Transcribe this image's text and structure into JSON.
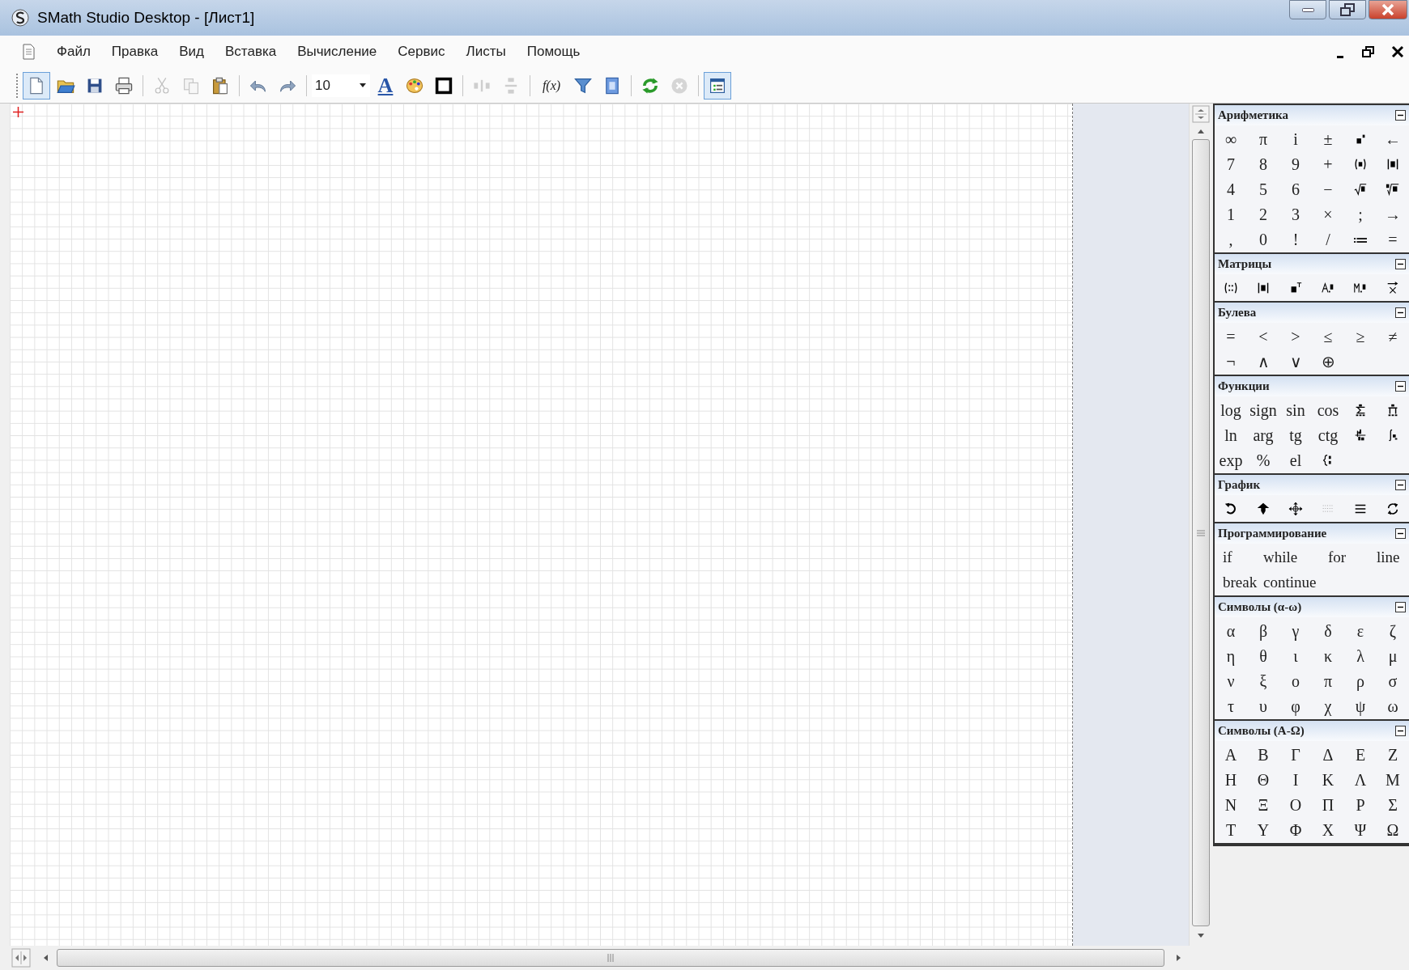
{
  "window": {
    "title": "SMath Studio Desktop - [Лист1]"
  },
  "menu": [
    "Файл",
    "Правка",
    "Вид",
    "Вставка",
    "Вычисление",
    "Сервис",
    "Листы",
    "Помощь"
  ],
  "toolbar": [
    {
      "kind": "new",
      "disabled": false,
      "pressed": true
    },
    {
      "kind": "open",
      "disabled": false,
      "pressed": false
    },
    {
      "kind": "save",
      "disabled": false,
      "pressed": false
    },
    {
      "kind": "print",
      "disabled": false,
      "pressed": false
    },
    {
      "kind": "separator"
    },
    {
      "kind": "cut",
      "disabled": true,
      "pressed": false
    },
    {
      "kind": "copy",
      "disabled": true,
      "pressed": false
    },
    {
      "kind": "paste",
      "disabled": false,
      "pressed": false
    },
    {
      "kind": "separator"
    },
    {
      "kind": "undo",
      "disabled": false,
      "pressed": false
    },
    {
      "kind": "redo",
      "disabled": false,
      "pressed": false
    },
    {
      "kind": "separator"
    },
    {
      "kind": "fontsize",
      "value": "10"
    },
    {
      "kind": "font",
      "label": "A",
      "disabled": false,
      "pressed": false
    },
    {
      "kind": "palette",
      "disabled": false,
      "pressed": false
    },
    {
      "kind": "border",
      "disabled": false,
      "pressed": false
    },
    {
      "kind": "separator"
    },
    {
      "kind": "alignh",
      "disabled": true,
      "pressed": false
    },
    {
      "kind": "alignv",
      "disabled": true,
      "pressed": false
    },
    {
      "kind": "separator"
    },
    {
      "kind": "fx",
      "label": "f(x)",
      "disabled": false,
      "pressed": false
    },
    {
      "kind": "filter",
      "disabled": false,
      "pressed": false
    },
    {
      "kind": "help",
      "disabled": false,
      "pressed": false
    },
    {
      "kind": "separator"
    },
    {
      "kind": "refresh",
      "disabled": false,
      "pressed": false
    },
    {
      "kind": "stop",
      "disabled": true,
      "pressed": false
    },
    {
      "kind": "separator"
    },
    {
      "kind": "sidebar",
      "disabled": false,
      "pressed": true
    }
  ],
  "panel": [
    {
      "title": "Арифметика",
      "expanded": true,
      "items": [
        {
          "kind": "symbol",
          "label": "∞"
        },
        {
          "kind": "symbol",
          "label": "π"
        },
        {
          "kind": "symbol",
          "label": "i"
        },
        {
          "kind": "symbol",
          "label": "±"
        },
        {
          "kind": "power"
        },
        {
          "kind": "symbol",
          "label": "←"
        },
        {
          "kind": "symbol",
          "label": "7"
        },
        {
          "kind": "symbol",
          "label": "8"
        },
        {
          "kind": "symbol",
          "label": "9"
        },
        {
          "kind": "symbol",
          "label": "+"
        },
        {
          "kind": "parens"
        },
        {
          "kind": "abs"
        },
        {
          "kind": "symbol",
          "label": "4"
        },
        {
          "kind": "symbol",
          "label": "5"
        },
        {
          "kind": "symbol",
          "label": "6"
        },
        {
          "kind": "symbol",
          "label": "−"
        },
        {
          "kind": "sqrt"
        },
        {
          "kind": "nroot"
        },
        {
          "kind": "symbol",
          "label": "1"
        },
        {
          "kind": "symbol",
          "label": "2"
        },
        {
          "kind": "symbol",
          "label": "3"
        },
        {
          "kind": "symbol",
          "label": "×"
        },
        {
          "kind": "symbol",
          "label": ";"
        },
        {
          "kind": "symbol",
          "label": "→"
        },
        {
          "kind": "symbol",
          "label": ","
        },
        {
          "kind": "symbol",
          "label": "0"
        },
        {
          "kind": "symbol",
          "label": "!"
        },
        {
          "kind": "symbol",
          "label": "/"
        },
        {
          "kind": "symbol",
          "label": "≔"
        },
        {
          "kind": "symbol",
          "label": "="
        }
      ]
    },
    {
      "title": "Матрицы",
      "expanded": true,
      "items": [
        {
          "kind": "matrix"
        },
        {
          "kind": "abs"
        },
        {
          "kind": "transpose"
        },
        {
          "kind": "algadd"
        },
        {
          "kind": "minor"
        },
        {
          "kind": "cross"
        }
      ]
    },
    {
      "title": "Булева",
      "expanded": true,
      "items": [
        {
          "kind": "symbol",
          "label": "="
        },
        {
          "kind": "symbol",
          "label": "<"
        },
        {
          "kind": "symbol",
          "label": ">"
        },
        {
          "kind": "symbol",
          "label": "≤"
        },
        {
          "kind": "symbol",
          "label": "≥"
        },
        {
          "kind": "symbol",
          "label": "≠"
        },
        {
          "kind": "symbol",
          "label": "¬"
        },
        {
          "kind": "symbol",
          "label": "∧"
        },
        {
          "kind": "symbol",
          "label": "∨"
        },
        {
          "kind": "symbol",
          "label": "⊕"
        }
      ]
    },
    {
      "title": "Функции",
      "expanded": true,
      "items": [
        {
          "kind": "symbol",
          "label": "log"
        },
        {
          "kind": "symbol",
          "label": "sign"
        },
        {
          "kind": "symbol",
          "label": "sin"
        },
        {
          "kind": "symbol",
          "label": "cos"
        },
        {
          "kind": "sum"
        },
        {
          "kind": "product"
        },
        {
          "kind": "symbol",
          "label": "ln"
        },
        {
          "kind": "symbol",
          "label": "arg"
        },
        {
          "kind": "symbol",
          "label": "tg"
        },
        {
          "kind": "symbol",
          "label": "ctg"
        },
        {
          "kind": "derivative"
        },
        {
          "kind": "integral"
        },
        {
          "kind": "symbol",
          "label": "exp"
        },
        {
          "kind": "symbol",
          "label": "%"
        },
        {
          "kind": "symbol",
          "label": "el"
        },
        {
          "kind": "piecewise"
        }
      ]
    },
    {
      "title": "График",
      "expanded": true,
      "items": [
        {
          "kind": "rotate"
        },
        {
          "kind": "uparrow"
        },
        {
          "kind": "move"
        },
        {
          "kind": "dots"
        },
        {
          "kind": "lines"
        },
        {
          "kind": "refresh2"
        }
      ]
    },
    {
      "title": "Программирование",
      "expanded": true,
      "items": [
        {
          "kind": "word",
          "label": "if"
        },
        {
          "kind": "word",
          "label": "while"
        },
        {
          "kind": "word",
          "label": "for"
        },
        {
          "kind": "word",
          "label": "line"
        },
        {
          "kind": "word",
          "label": "break"
        },
        {
          "kind": "word",
          "label": "continue"
        }
      ]
    },
    {
      "title": "Символы (α-ω)",
      "expanded": true,
      "items": [
        {
          "kind": "symbol",
          "label": "α"
        },
        {
          "kind": "symbol",
          "label": "β"
        },
        {
          "kind": "symbol",
          "label": "γ"
        },
        {
          "kind": "symbol",
          "label": "δ"
        },
        {
          "kind": "symbol",
          "label": "ε"
        },
        {
          "kind": "symbol",
          "label": "ζ"
        },
        {
          "kind": "symbol",
          "label": "η"
        },
        {
          "kind": "symbol",
          "label": "θ"
        },
        {
          "kind": "symbol",
          "label": "ι"
        },
        {
          "kind": "symbol",
          "label": "κ"
        },
        {
          "kind": "symbol",
          "label": "λ"
        },
        {
          "kind": "symbol",
          "label": "μ"
        },
        {
          "kind": "symbol",
          "label": "ν"
        },
        {
          "kind": "symbol",
          "label": "ξ"
        },
        {
          "kind": "symbol",
          "label": "ο"
        },
        {
          "kind": "symbol",
          "label": "π"
        },
        {
          "kind": "symbol",
          "label": "ρ"
        },
        {
          "kind": "symbol",
          "label": "σ"
        },
        {
          "kind": "symbol",
          "label": "τ"
        },
        {
          "kind": "symbol",
          "label": "υ"
        },
        {
          "kind": "symbol",
          "label": "φ"
        },
        {
          "kind": "symbol",
          "label": "χ"
        },
        {
          "kind": "symbol",
          "label": "ψ"
        },
        {
          "kind": "symbol",
          "label": "ω"
        }
      ]
    },
    {
      "title": "Символы (Α-Ω)",
      "expanded": true,
      "items": [
        {
          "kind": "symbol",
          "label": "Α"
        },
        {
          "kind": "symbol",
          "label": "Β"
        },
        {
          "kind": "symbol",
          "label": "Γ"
        },
        {
          "kind": "symbol",
          "label": "Δ"
        },
        {
          "kind": "symbol",
          "label": "Ε"
        },
        {
          "kind": "symbol",
          "label": "Ζ"
        },
        {
          "kind": "symbol",
          "label": "Η"
        },
        {
          "kind": "symbol",
          "label": "Θ"
        },
        {
          "kind": "symbol",
          "label": "Ι"
        },
        {
          "kind": "symbol",
          "label": "Κ"
        },
        {
          "kind": "symbol",
          "label": "Λ"
        },
        {
          "kind": "symbol",
          "label": "Μ"
        },
        {
          "kind": "symbol",
          "label": "Ν"
        },
        {
          "kind": "symbol",
          "label": "Ξ"
        },
        {
          "kind": "symbol",
          "label": "Ο"
        },
        {
          "kind": "symbol",
          "label": "Π"
        },
        {
          "kind": "symbol",
          "label": "Ρ"
        },
        {
          "kind": "symbol",
          "label": "Σ"
        },
        {
          "kind": "symbol",
          "label": "Τ"
        },
        {
          "kind": "symbol",
          "label": "Υ"
        },
        {
          "kind": "symbol",
          "label": "Φ"
        },
        {
          "kind": "symbol",
          "label": "Χ"
        },
        {
          "kind": "symbol",
          "label": "Ψ"
        },
        {
          "kind": "symbol",
          "label": "Ω"
        }
      ]
    }
  ]
}
